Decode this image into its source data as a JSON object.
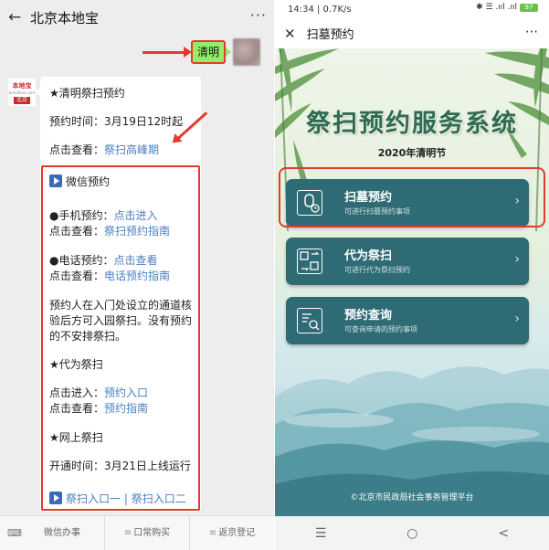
{
  "left": {
    "header": {
      "title": "北京本地宝",
      "back_icon": "back-arrow-icon",
      "more": "···"
    },
    "sent_message": "清明",
    "sender_logo": {
      "top": "本地宝",
      "bottom": "北京"
    },
    "message": {
      "line1": "★清明祭扫预约",
      "line2_prefix": "预约时间：3月19日12时起",
      "line3_prefix": "点击查看：",
      "line3_link": "祭扫高峰期",
      "wechat_title": "微信预约",
      "phone_reserve_prefix": "●手机预约：",
      "phone_reserve_link": "点击进入",
      "guide1_prefix": "点击查看：",
      "guide1_link": "祭扫预约指南",
      "tel_reserve_prefix": "●电话预约：",
      "tel_reserve_link": "点击查看",
      "guide2_prefix": "点击查看：",
      "guide2_link": "电话预约指南",
      "note1": "预约人在入门处设立的通道核",
      "note2": "验后方可入园祭扫。没有预约",
      "note3": "的不安排祭扫。",
      "proxy_title": "★代为祭扫",
      "proxy_enter_prefix": "点击进入：",
      "proxy_enter_link": "预约入口",
      "proxy_guide_prefix": "点击查看：",
      "proxy_guide_link": "预约指南",
      "online_title": "★网上祭扫",
      "online_time": "开通时间：3月21日上线运行",
      "entry1": "祭扫入口一",
      "sep": " | ",
      "entry2": "祭扫入口二"
    },
    "footer": {
      "menu": [
        "微信办事",
        "口常购买",
        "返京登记"
      ]
    }
  },
  "right": {
    "status": {
      "time": "14:34 | 0.7K/s",
      "icons": "✱ ☰ .ııl .ııl",
      "battery": "97"
    },
    "header": {
      "close": "✕",
      "title": "扫墓预约",
      "more": "···"
    },
    "main_title": "祭扫预约服务系统",
    "subtitle": "2020年清明节",
    "cards": [
      {
        "title": "扫墓预约",
        "desc": "可进行扫墓预约事项",
        "icon": "grave-calendar-icon"
      },
      {
        "title": "代为祭扫",
        "desc": "可进行代为祭扫预约",
        "icon": "proxy-swap-icon"
      },
      {
        "title": "预约查询",
        "desc": "可查询申请的预约事项",
        "icon": "search-document-icon"
      }
    ],
    "copyright": "©北京市民政局社会事务管理平台",
    "nav": {
      "menu": "☰",
      "home": "○",
      "back": "<"
    }
  },
  "colors": {
    "highlight_red": "#e23b2e",
    "card_teal": "#2f6b74",
    "link_blue": "#4a7fc2",
    "bubble_green": "#95ec69"
  }
}
